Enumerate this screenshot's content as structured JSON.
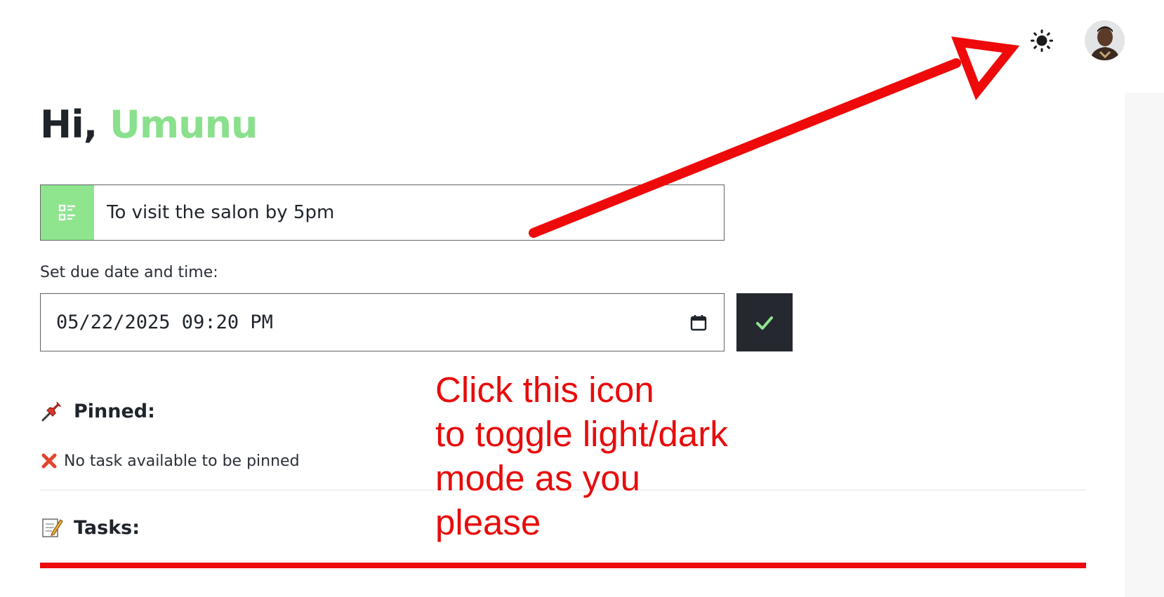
{
  "header": {
    "theme_toggle_icon": "sun-icon",
    "avatar_icon": "user-avatar"
  },
  "greeting": {
    "prefix": "Hi, ",
    "name": "Umunu"
  },
  "task_input": {
    "icon": "list-icon",
    "value": "To visit the salon by 5pm"
  },
  "due": {
    "label": "Set due date and time:",
    "value": "05/22/2025 09:20 PM",
    "calendar_icon": "calendar-icon",
    "confirm_icon": "check-icon"
  },
  "pinned": {
    "icon": "pushpin-icon",
    "title": "Pinned:",
    "empty_icon": "cross-mark-icon",
    "empty_text": "No task available to be pinned"
  },
  "tasks": {
    "icon": "memo-icon",
    "title": "Tasks:"
  },
  "annotation": {
    "text": "Click this icon\nto toggle light/dark\nmode as you\nplease"
  },
  "colors": {
    "accent_green": "#8ae08d",
    "annotation_red": "#e80c0c",
    "dark_button": "#25292f"
  }
}
